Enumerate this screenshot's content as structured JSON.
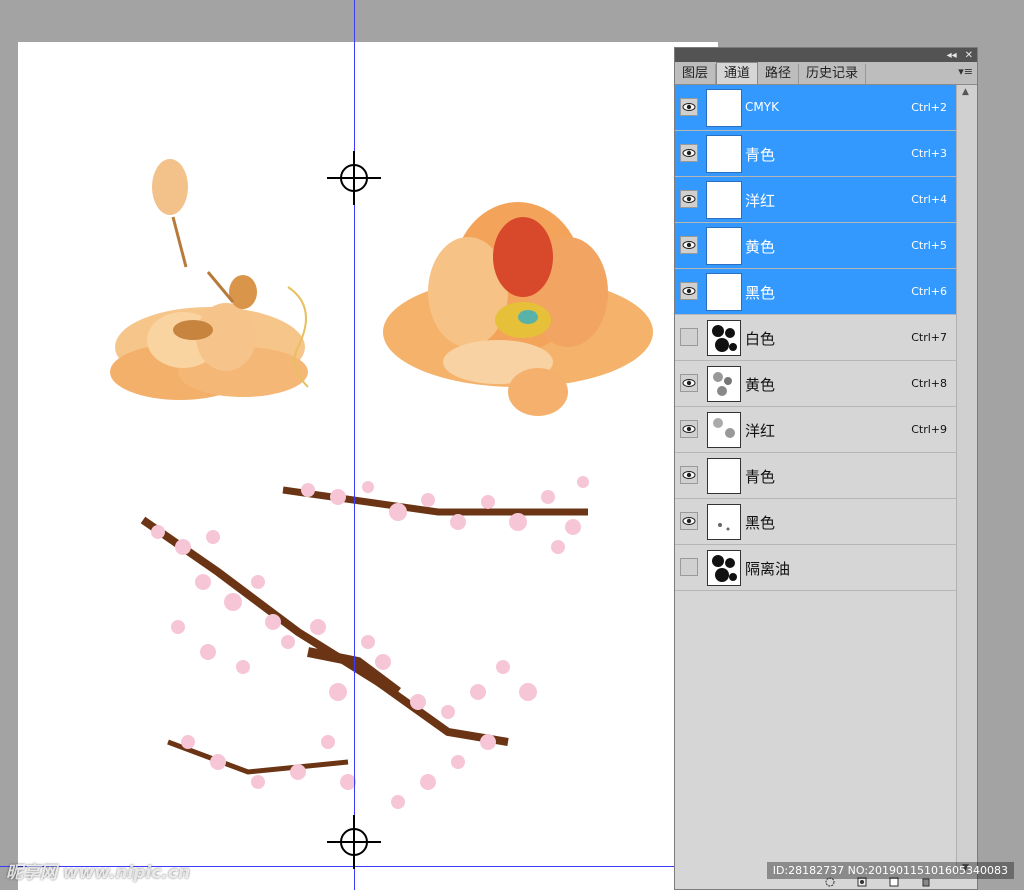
{
  "panel": {
    "tabs": [
      {
        "label": "图层",
        "active": false
      },
      {
        "label": "通道",
        "active": true
      },
      {
        "label": "路径",
        "active": false
      },
      {
        "label": "历史记录",
        "active": false
      }
    ],
    "channels": [
      {
        "name": "CMYK",
        "shortcut": "Ctrl+2",
        "visible": true,
        "selected": true
      },
      {
        "name": "青色",
        "shortcut": "Ctrl+3",
        "visible": true,
        "selected": true
      },
      {
        "name": "洋红",
        "shortcut": "Ctrl+4",
        "visible": true,
        "selected": true
      },
      {
        "name": "黄色",
        "shortcut": "Ctrl+5",
        "visible": true,
        "selected": true
      },
      {
        "name": "黑色",
        "shortcut": "Ctrl+6",
        "visible": true,
        "selected": true
      },
      {
        "name": "白色",
        "shortcut": "Ctrl+7",
        "visible": false,
        "selected": false
      },
      {
        "name": "黄色",
        "shortcut": "Ctrl+8",
        "visible": true,
        "selected": false
      },
      {
        "name": "洋红",
        "shortcut": "Ctrl+9",
        "visible": true,
        "selected": false
      },
      {
        "name": "青色",
        "shortcut": "",
        "visible": true,
        "selected": false
      },
      {
        "name": "黑色",
        "shortcut": "",
        "visible": true,
        "selected": false
      },
      {
        "name": "隔离油",
        "shortcut": "",
        "visible": false,
        "selected": false
      }
    ]
  },
  "watermark": {
    "left": "昵享网 www.nipic.cn",
    "right": "ID:28182737 NO:20190115101605340083"
  },
  "colors": {
    "selection": "#3399ff",
    "guide": "#3b3bff",
    "panel": "#d6d6d6"
  }
}
